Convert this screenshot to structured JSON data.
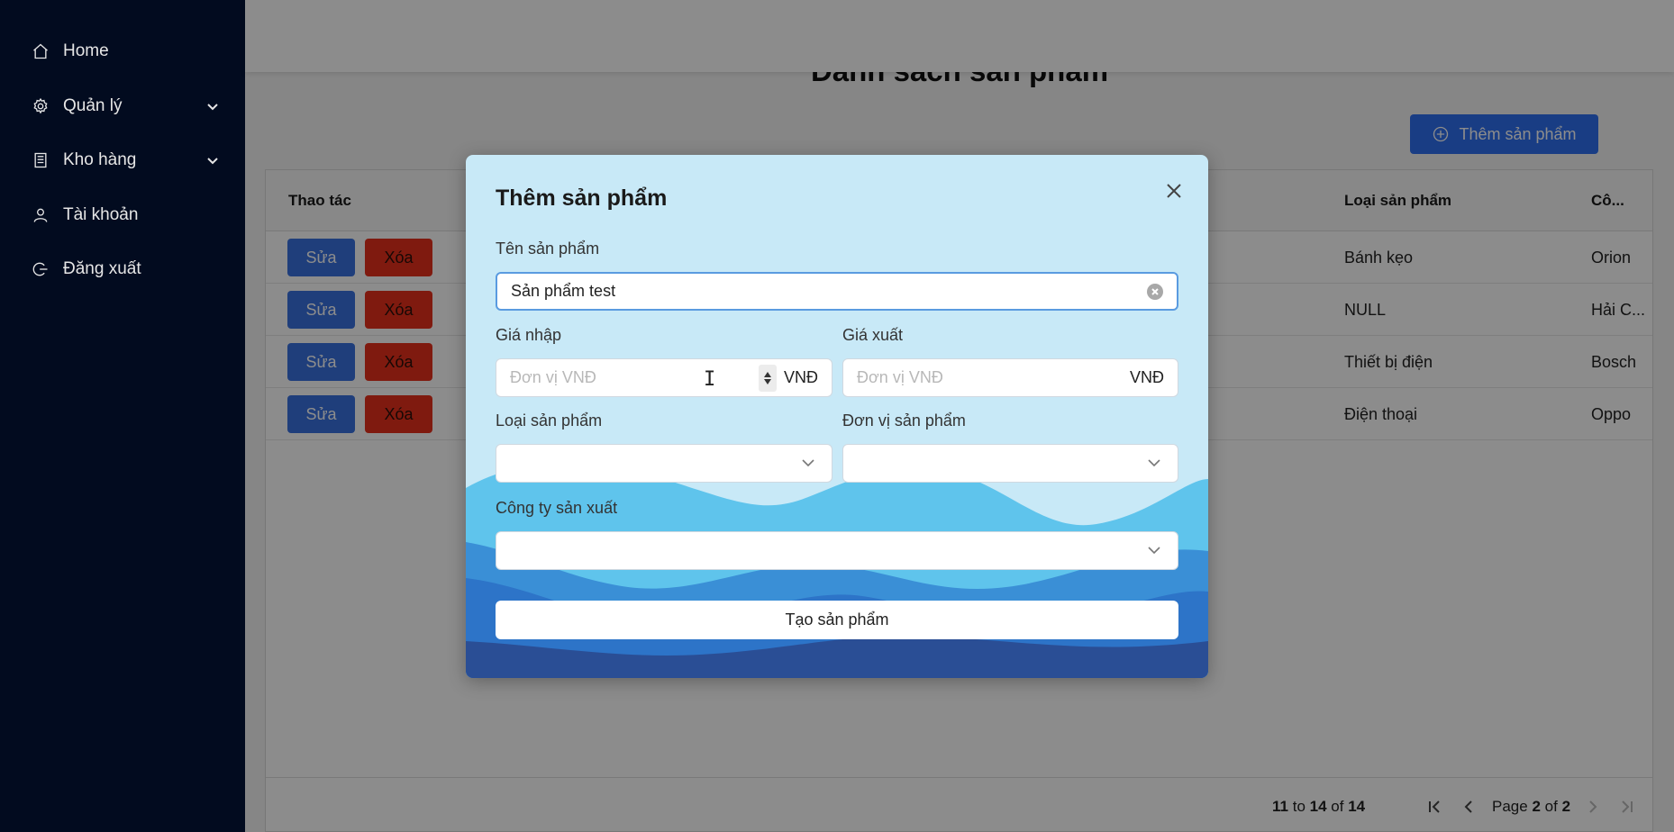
{
  "sidebar": {
    "items": [
      {
        "label": "Home",
        "icon": "home-icon"
      },
      {
        "label": "Quản lý",
        "icon": "gear-icon",
        "expandable": true
      },
      {
        "label": "Kho hàng",
        "icon": "warehouse-icon",
        "expandable": true
      },
      {
        "label": "Tài khoản",
        "icon": "user-icon"
      },
      {
        "label": "Đăng xuất",
        "icon": "logout-icon"
      }
    ]
  },
  "main": {
    "page_title": "Danh sách sản phẩm",
    "add_button": "Thêm sản phẩm",
    "table": {
      "headers": {
        "actions": "Thao tác",
        "category": "Loại sản phẩm",
        "company": "Cô..."
      },
      "edit_label": "Sửa",
      "delete_label": "Xóa",
      "rows": [
        {
          "category": "Bánh kẹo",
          "company": "Orion"
        },
        {
          "category": "NULL",
          "company": "Hải C..."
        },
        {
          "category": "Thiết bị điện",
          "company": "Bosch"
        },
        {
          "category": "Điện thoại",
          "company": "Oppo"
        }
      ]
    },
    "pagination": {
      "from": "11",
      "to_word": "to",
      "to": "14",
      "of_word": "of",
      "total": "14",
      "page_word": "Page",
      "page": "2",
      "page_of_word": "of",
      "pages": "2"
    }
  },
  "modal": {
    "title": "Thêm sản phẩm",
    "name_label": "Tên sản phẩm",
    "name_value": "Sản phẩm test",
    "import_price_label": "Giá nhập",
    "import_price_placeholder": "Đơn vị VNĐ",
    "export_price_label": "Giá xuất",
    "export_price_placeholder": "Đơn vị VNĐ",
    "currency": "VNĐ",
    "category_label": "Loại sản phẩm",
    "unit_label": "Đơn vị sản phẩm",
    "company_label": "Công ty sản xuất",
    "submit_label": "Tạo sản phẩm"
  },
  "colors": {
    "sidebar_bg": "#020b1f",
    "primary_button": "#2f6ff0",
    "edit_button": "#3a72e0",
    "delete_button": "#e8311c",
    "modal_bg": "#c8e9f7",
    "wave_light": "#5fc4ec",
    "wave_mid": "#3a8fd6",
    "wave_dark": "#2a4e95"
  }
}
